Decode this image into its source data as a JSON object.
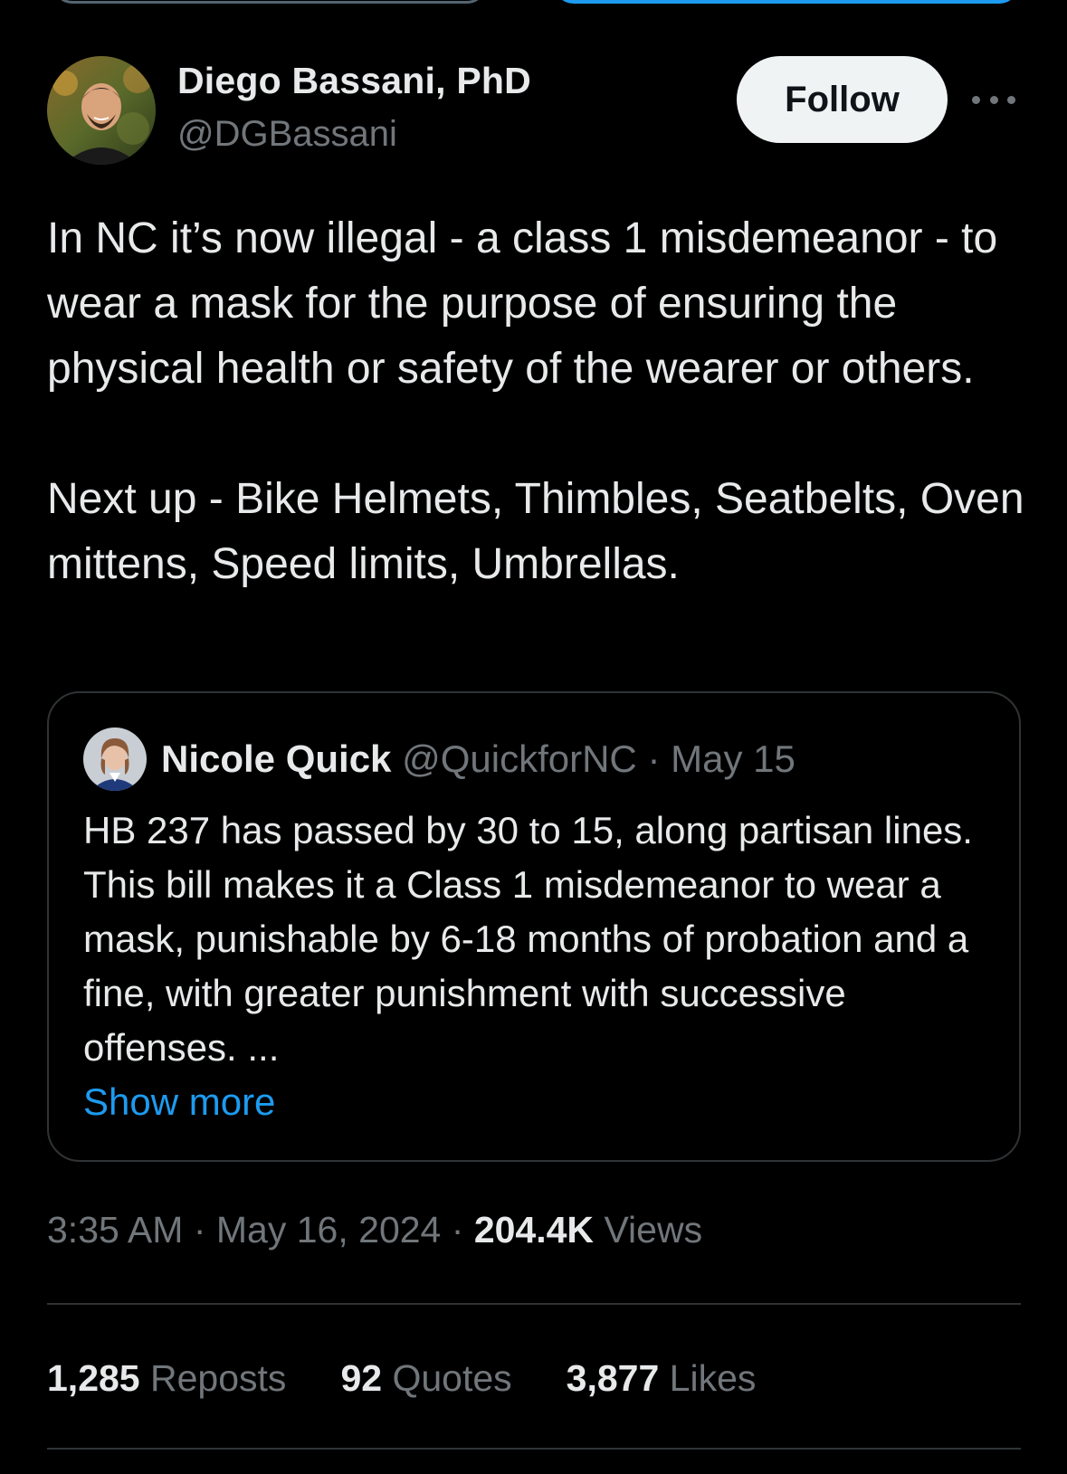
{
  "tweet": {
    "author": {
      "name": "Diego Bassani, PhD",
      "handle": "@DGBassani"
    },
    "follow_label": "Follow",
    "more_icon": "more-horizontal-icon",
    "paragraphs": [
      "In NC it’s now illegal - a class 1 misdemeanor - to wear a mask for the purpose of ensuring the physical health or safety of the wearer or others.",
      "Next up - Bike Helmets, Thimbles, Seatbelts, Oven mittens, Speed limits, Umbrellas."
    ],
    "quote": {
      "name": "Nicole Quick",
      "handle": "@QuickforNC",
      "separator": "·",
      "date": "May 15",
      "text": "HB 237 has passed by 30 to 15, along partisan lines. This bill makes it a Class 1 misdemeanor to wear a mask, punishable by 6-18 months of probation and a fine, with greater punishment with successive offenses. ...",
      "show_more": "Show more"
    },
    "time": "3:35 AM",
    "separator": "·",
    "date": "May 16, 2024",
    "views_count": "204.4K",
    "views_label": "Views",
    "stats": {
      "reposts_count": "1,285",
      "reposts_label": "Reposts",
      "quotes_count": "92",
      "quotes_label": "Quotes",
      "likes_count": "3,877",
      "likes_label": "Likes"
    }
  },
  "colors": {
    "background": "#000000",
    "text": "#e7e9ea",
    "secondary_text": "#71767b",
    "link": "#1d9bf0",
    "border": "#2f3336",
    "follow_button_bg": "#eff3f4"
  }
}
